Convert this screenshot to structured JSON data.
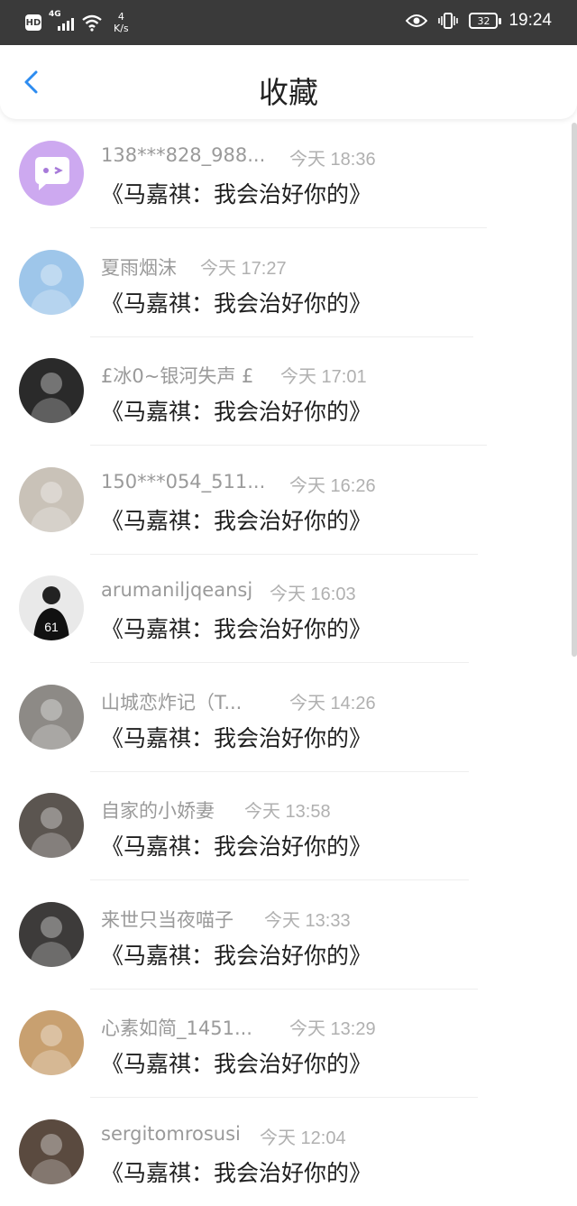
{
  "status_bar": {
    "hd": "HD",
    "network": "4G",
    "speed_value": "4",
    "speed_unit": "K/s",
    "battery": "32",
    "time": "19:24"
  },
  "header": {
    "title": "收藏",
    "back_icon": "chevron-left-icon"
  },
  "items": [
    {
      "name": "138***828_988...",
      "time": "今天 18:36",
      "message": "《马嘉祺：我会治好你的》",
      "avatar": "chat-bubble-avatar",
      "avatar_color": "#cda9f0"
    },
    {
      "name": "夏雨烟沫",
      "time": "今天 17:27",
      "message": "《马嘉祺：我会治好你的》",
      "avatar": "anime-girl-avatar",
      "avatar_color": "#9ec6ea"
    },
    {
      "name": "£冰0~银河失声 £",
      "time": "今天 17:01",
      "message": "《马嘉祺：我会治好你的》",
      "avatar": "sketch-girl-avatar",
      "avatar_color": "#2a2a2a"
    },
    {
      "name": "150***054_511...",
      "time": "今天 16:26",
      "message": "《马嘉祺：我会治好你的》",
      "avatar": "photo-avatar",
      "avatar_color": "#c9c2b8"
    },
    {
      "name": "arumaniljqeansj",
      "time": "今天 16:03",
      "message": "《马嘉祺：我会治好你的》",
      "avatar": "jersey-61-avatar",
      "avatar_color": "#e9e9e9"
    },
    {
      "name": "山城恋炸记（T...",
      "time": "今天 14:26",
      "message": "《马嘉祺：我会治好你的》",
      "avatar": "group-photo-avatar",
      "avatar_color": "#8d8a86"
    },
    {
      "name": "自家的小娇妻",
      "time": "今天 13:58",
      "message": "《马嘉祺：我会治好你的》",
      "avatar": "group-photo-avatar",
      "avatar_color": "#5b5550"
    },
    {
      "name": "来世只当夜喵子",
      "time": "今天 13:33",
      "message": "《马嘉祺：我会治好你的》",
      "avatar": "photo-avatar",
      "avatar_color": "#3d3b3a"
    },
    {
      "name": "心素如简_1451...",
      "time": "今天 13:29",
      "message": "《马嘉祺：我会治好你的》",
      "avatar": "photo-avatar",
      "avatar_color": "#c8a070"
    },
    {
      "name": "sergitomrosusi",
      "time": "今天 12:04",
      "message": "《马嘉祺：我会治好你的》",
      "avatar": "sunset-photo-avatar",
      "avatar_color": "#5a4a3f"
    }
  ]
}
